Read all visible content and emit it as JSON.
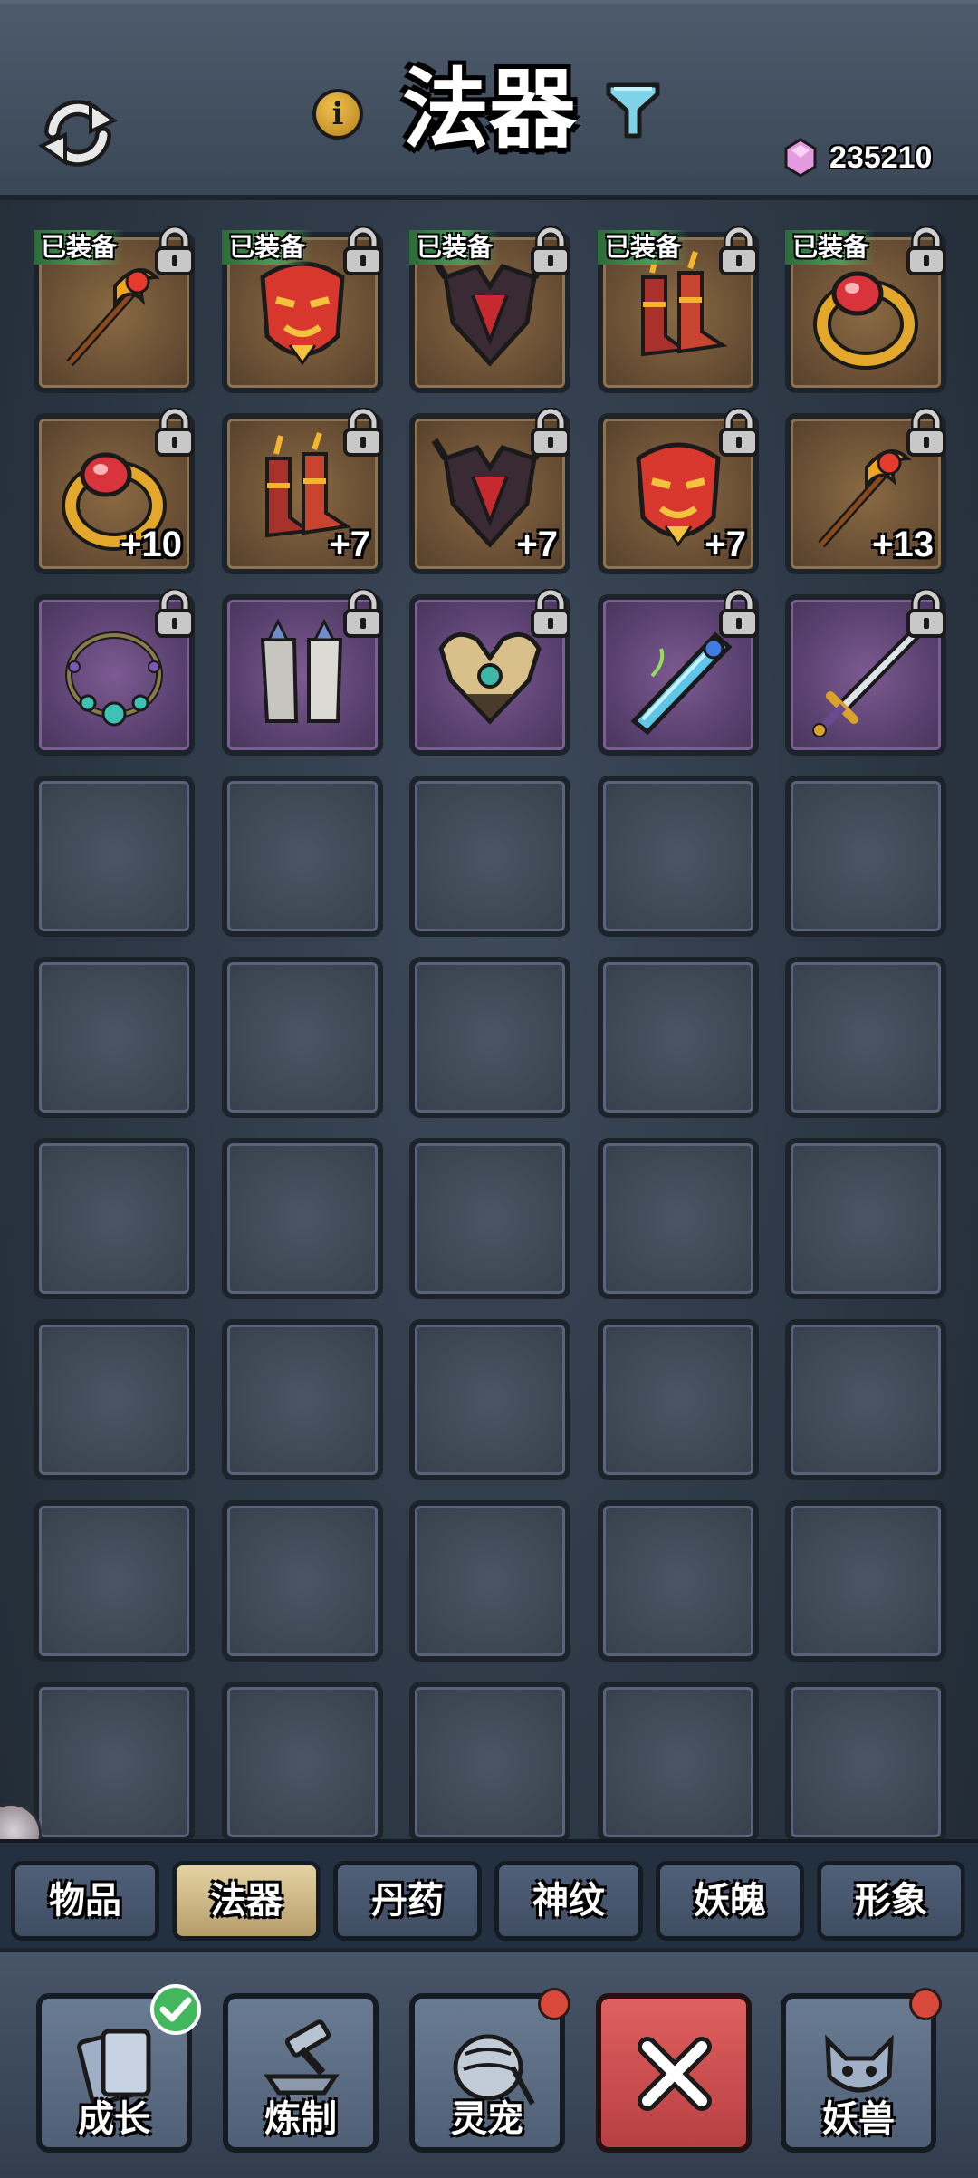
{
  "header": {
    "title": "法器",
    "currency_value": "235210",
    "icons": {
      "refresh": "refresh-icon",
      "info": "info-icon",
      "filter": "filter-icon",
      "currency": "gem-icon"
    }
  },
  "equipped_label": "已装备",
  "colors": {
    "gold_slot": "#6b5035",
    "purple_slot": "#5b4271",
    "empty_slot": "#3d4653",
    "equipped_tag": "#4b9e58",
    "active_tab": "#e4d2a4",
    "close_button": "#d65356"
  },
  "items": [
    {
      "name": "staff",
      "quality": "gold",
      "equipped": true,
      "level": ""
    },
    {
      "name": "mask",
      "quality": "gold",
      "equipped": true,
      "level": ""
    },
    {
      "name": "armor",
      "quality": "gold",
      "equipped": true,
      "level": ""
    },
    {
      "name": "boots",
      "quality": "gold",
      "equipped": true,
      "level": ""
    },
    {
      "name": "ring",
      "quality": "gold",
      "equipped": true,
      "level": ""
    },
    {
      "name": "ring",
      "quality": "gold",
      "equipped": false,
      "level": "+10"
    },
    {
      "name": "boots",
      "quality": "gold",
      "equipped": false,
      "level": "+7"
    },
    {
      "name": "armor",
      "quality": "gold",
      "equipped": false,
      "level": "+7"
    },
    {
      "name": "mask",
      "quality": "gold",
      "equipped": false,
      "level": "+7"
    },
    {
      "name": "staff",
      "quality": "gold",
      "equipped": false,
      "level": "+13"
    },
    {
      "name": "necklace",
      "quality": "purple",
      "equipped": false,
      "level": ""
    },
    {
      "name": "gauntlets",
      "quality": "purple",
      "equipped": false,
      "level": ""
    },
    {
      "name": "golden-armor",
      "quality": "purple",
      "equipped": false,
      "level": ""
    },
    {
      "name": "blue-blade",
      "quality": "purple",
      "equipped": false,
      "level": ""
    },
    {
      "name": "sword",
      "quality": "purple",
      "equipped": false,
      "level": ""
    }
  ],
  "tabs": [
    {
      "label": "物品",
      "active": false
    },
    {
      "label": "法器",
      "active": true
    },
    {
      "label": "丹药",
      "active": false
    },
    {
      "label": "神纹",
      "active": false
    },
    {
      "label": "妖魄",
      "active": false
    },
    {
      "label": "形象",
      "active": false
    }
  ],
  "nav": [
    {
      "label": "成长",
      "icon": "cards-icon",
      "badge": "check"
    },
    {
      "label": "炼制",
      "icon": "anvil-hammer-icon",
      "badge": ""
    },
    {
      "label": "灵宠",
      "icon": "pet-icon",
      "badge": "dot"
    },
    {
      "label": "",
      "icon": "close-icon",
      "badge": ""
    },
    {
      "label": "妖兽",
      "icon": "beast-icon",
      "badge": "dot"
    }
  ]
}
